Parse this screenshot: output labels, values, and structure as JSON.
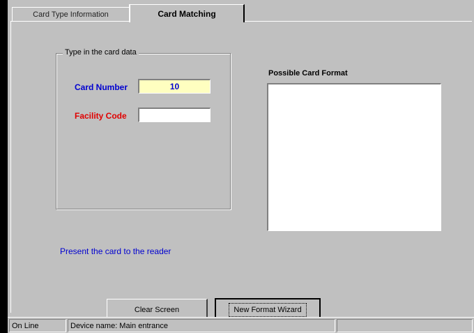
{
  "tabs": [
    {
      "label": "Card Type Information",
      "active": false
    },
    {
      "label": "Card Matching",
      "active": true
    }
  ],
  "group": {
    "legend": "Type in the card data",
    "card_number_label": "Card Number",
    "card_number_value": "10",
    "facility_code_label": "Facility Code",
    "facility_code_value": ""
  },
  "possible_formats": {
    "title": "Possible Card Format",
    "items": []
  },
  "instruction": "Present the card to the reader",
  "buttons": {
    "clear": "Clear Screen",
    "wizard": "New Format Wizard"
  },
  "status": {
    "connection": "On Line",
    "device": "Device name: Main entrance",
    "extra": ""
  },
  "colors": {
    "label_blue": "#0000d0",
    "label_red": "#e00000",
    "field_highlight": "#ffffc0",
    "window_bg": "#c0c0c0"
  }
}
